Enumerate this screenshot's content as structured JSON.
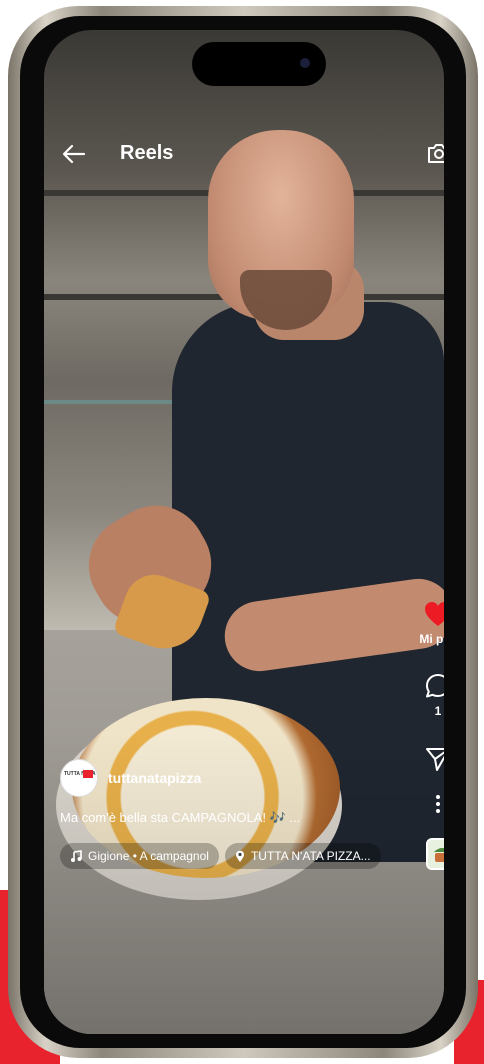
{
  "header": {
    "title": "Reels",
    "back_icon": "arrow-left-icon",
    "camera_icon": "camera-icon"
  },
  "actions": {
    "like": {
      "label": "Mi pi...",
      "color": "#ed1c24"
    },
    "comment": {
      "count": "1"
    }
  },
  "post": {
    "username": "tuttanatapizza",
    "caption": "Ma com'è bella sta CAMPAGNOLA! 🎶 ...",
    "music": "Gigione • A campagnol",
    "location": "TUTTA N'ATA PIZZA...",
    "avatar_text": "TUTTA N'ATA"
  },
  "colors": {
    "accent_red": "#e8232d",
    "frame_gold": "#c9c2b4"
  }
}
